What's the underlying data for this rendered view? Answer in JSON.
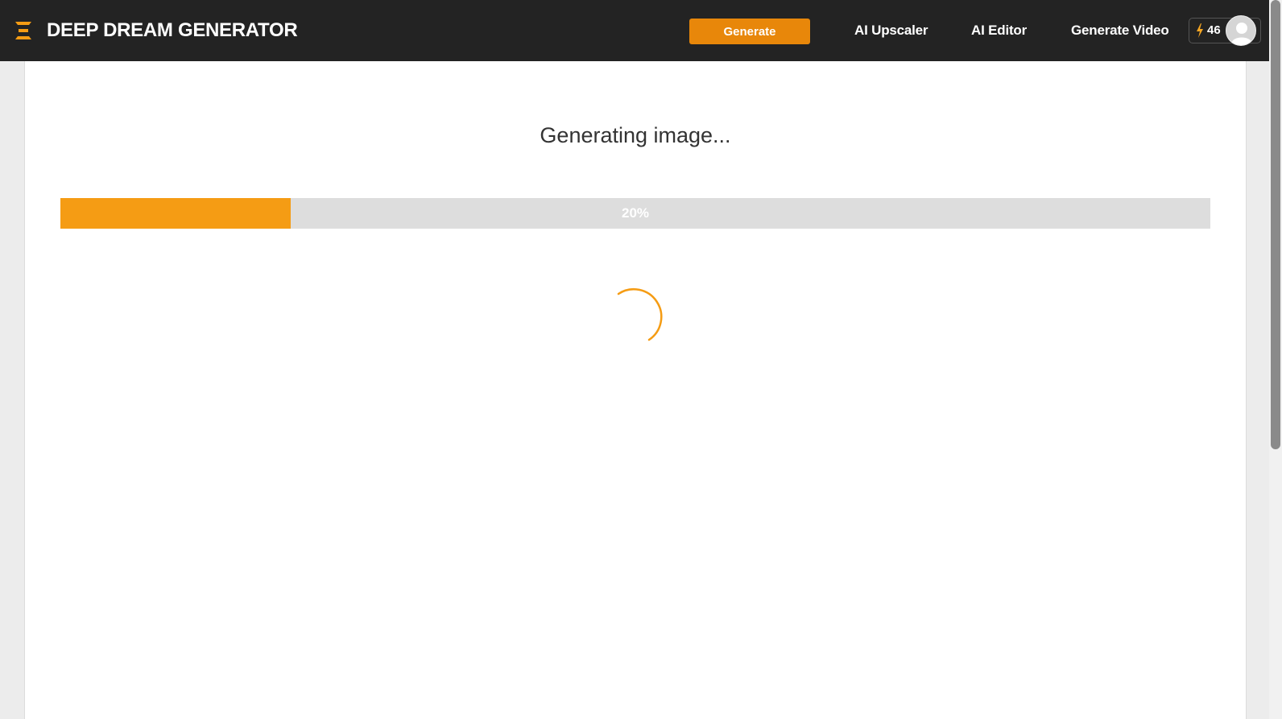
{
  "header": {
    "brand": "DEEP DREAM GENERATOR",
    "generate_label": "Generate",
    "nav": [
      "AI Upscaler",
      "AI Editor",
      "Generate Video"
    ],
    "credits": "46"
  },
  "main": {
    "status": "Generating image...",
    "progress": {
      "percent": 20,
      "label": "20%"
    }
  },
  "colors": {
    "accent": "#f59c14",
    "button": "#e8870a",
    "header_bg": "#232323"
  },
  "icons": {
    "logo": "stacked-bars-icon",
    "credits": "lightning-bolt-icon",
    "avatar": "user-silhouette-icon",
    "loading": "spinner-icon"
  }
}
